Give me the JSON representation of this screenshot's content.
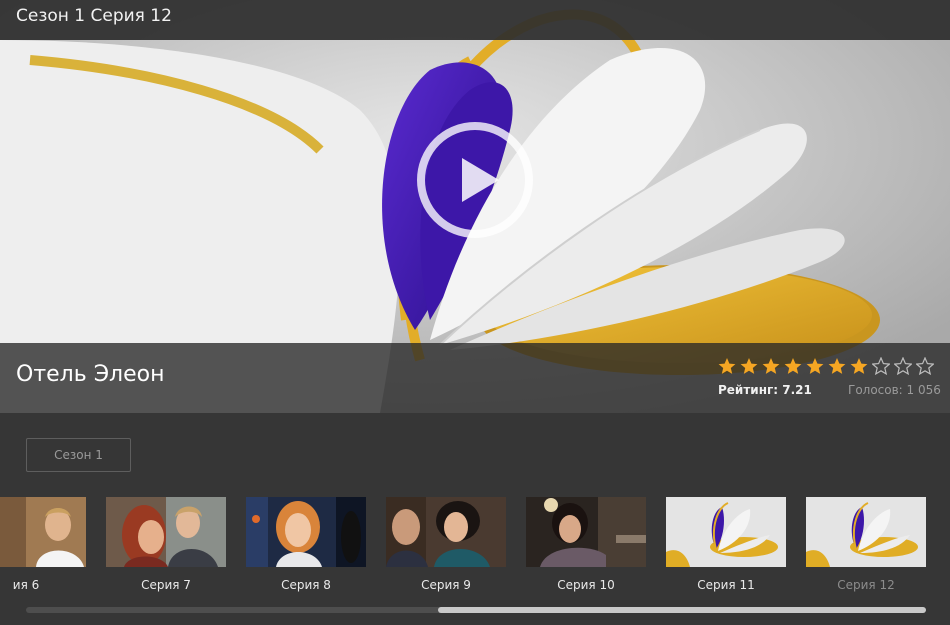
{
  "player": {
    "episode_title": "Сезон 1 Серия 12",
    "show_title": "Отель Элеон",
    "rating_label": "Рейтинг: 7.21",
    "votes_label": "Голосов: 1 056",
    "rating_value": 7.21,
    "rating_max": 10,
    "accent_color": "#f5a623"
  },
  "season_selector": {
    "label": "Сезон 1"
  },
  "episodes": [
    {
      "label": "ия 6"
    },
    {
      "label": "Серия 7"
    },
    {
      "label": "Серия 8"
    },
    {
      "label": "Серия 9"
    },
    {
      "label": "Серия 10"
    },
    {
      "label": "Серия 11"
    },
    {
      "label": "Серия 12"
    }
  ],
  "scrollbar": {
    "position_fraction": 0.54
  }
}
